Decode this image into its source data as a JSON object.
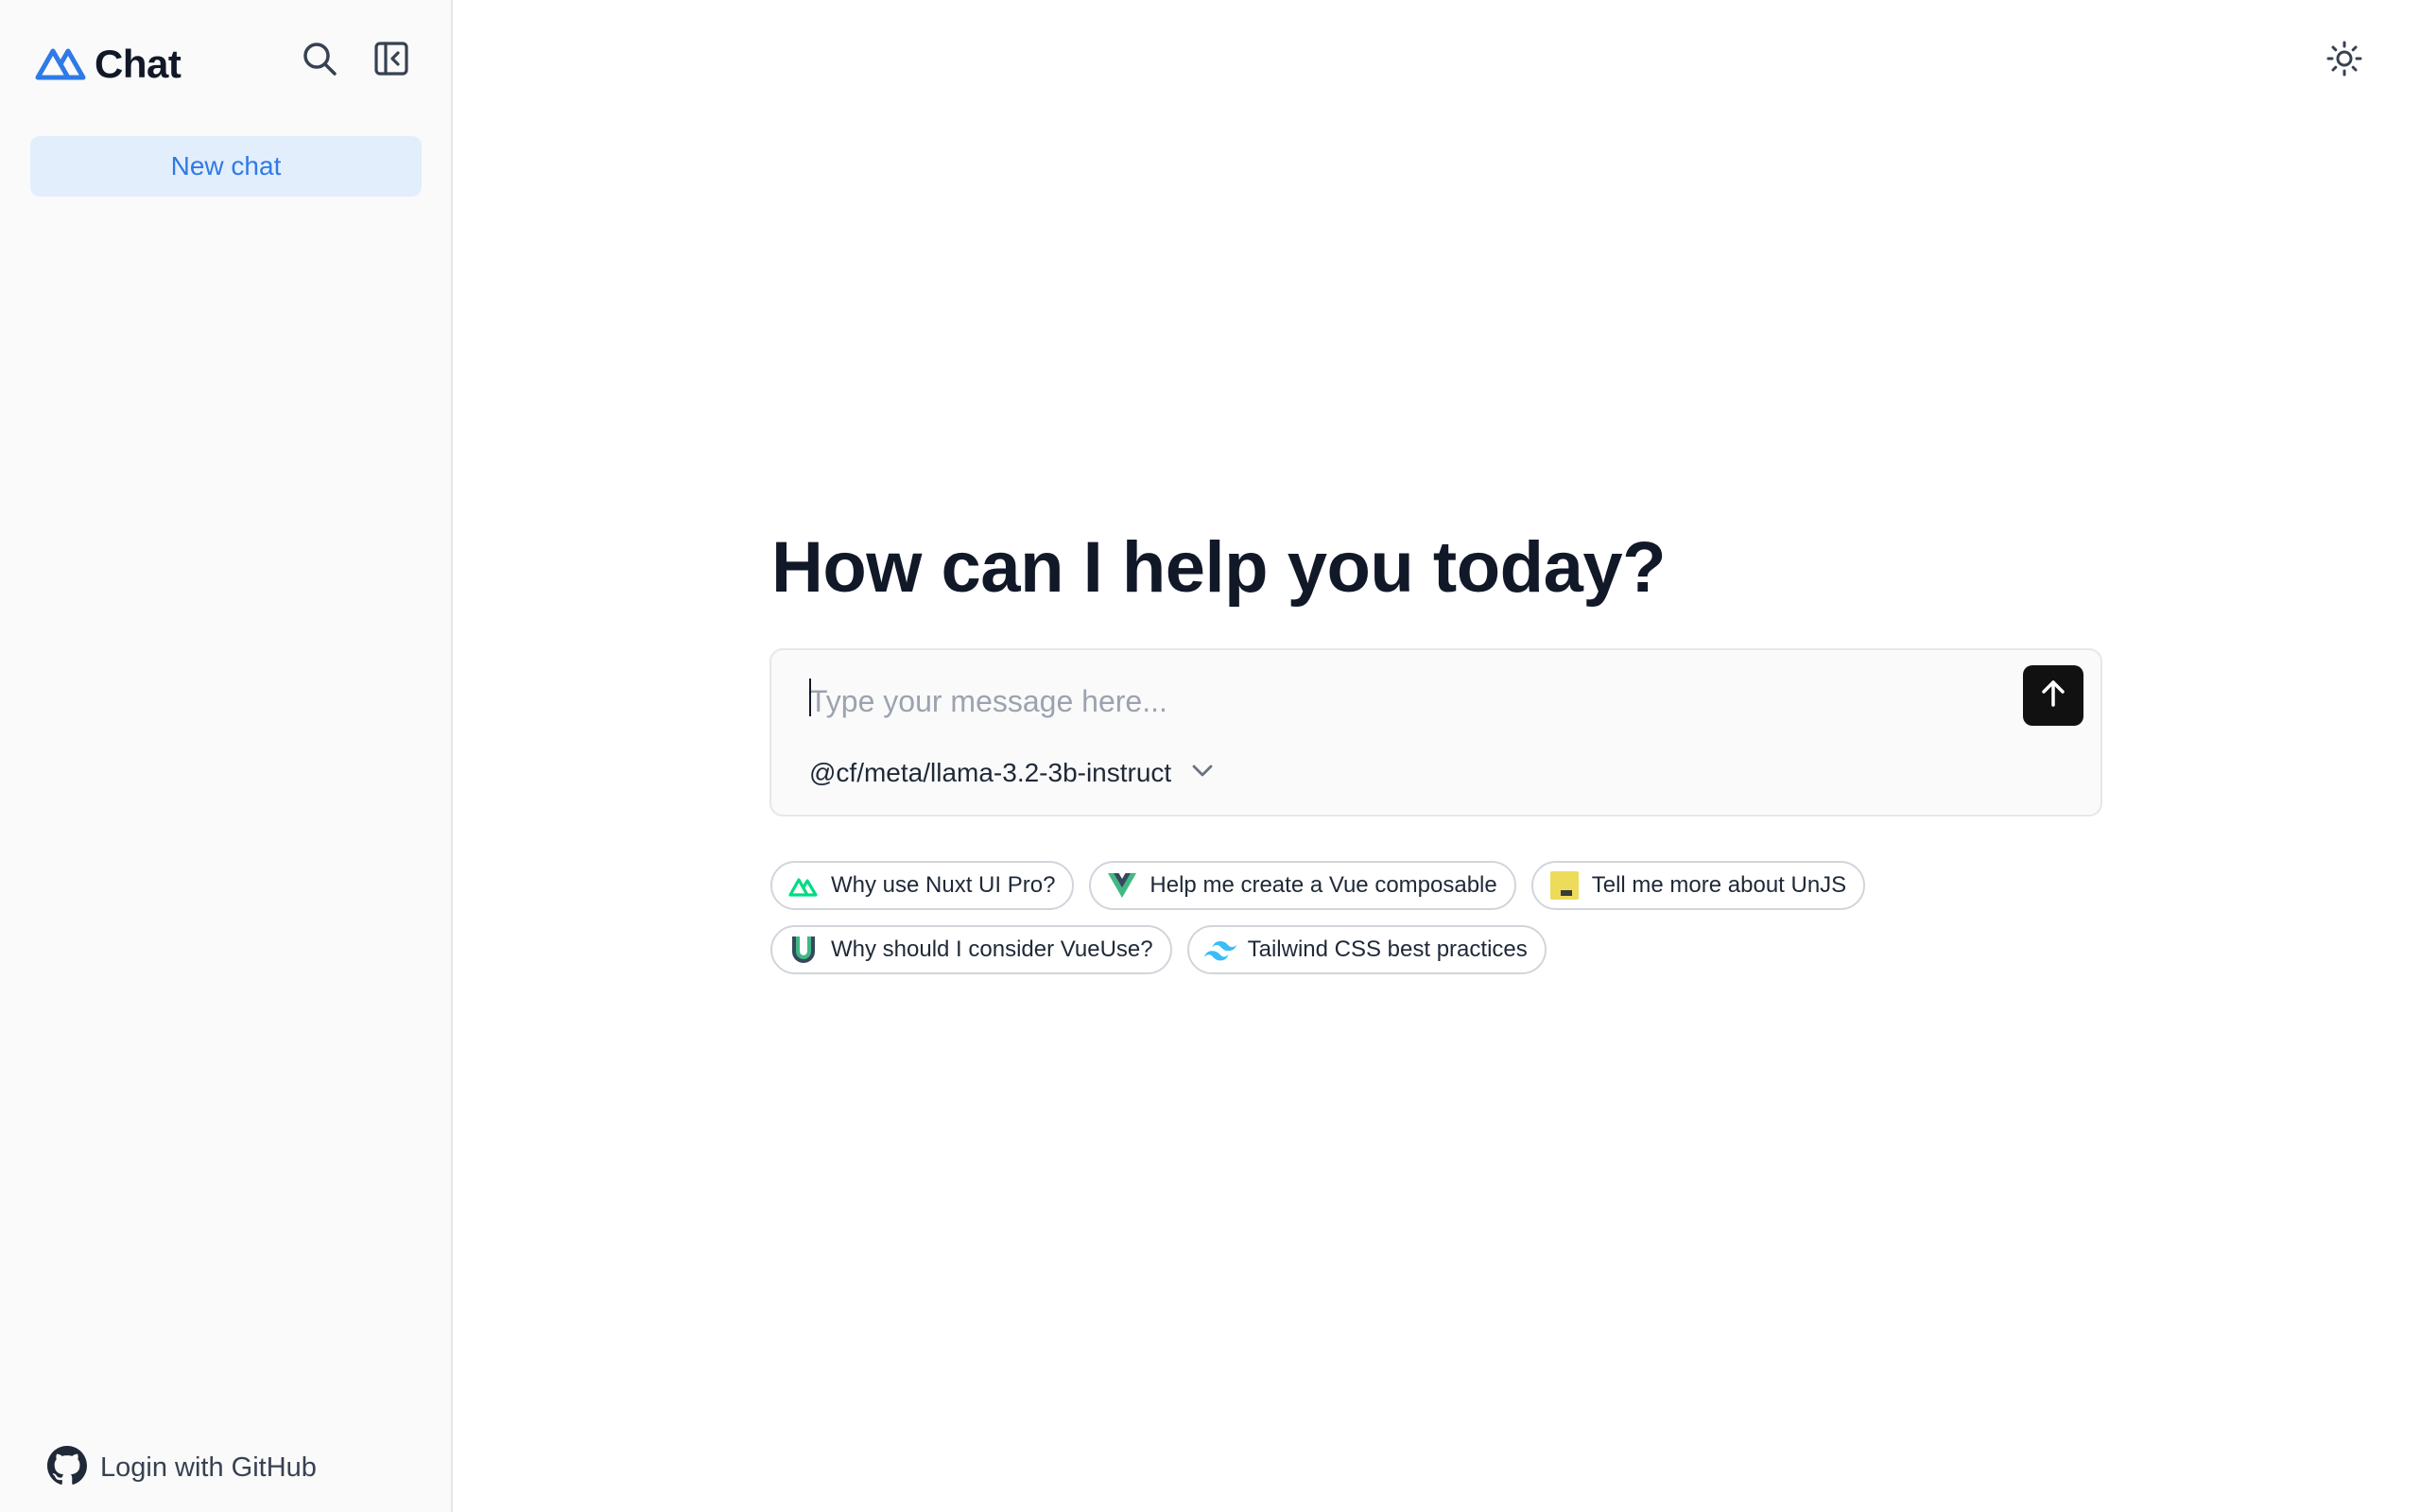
{
  "sidebar": {
    "brand_title": "Chat",
    "new_chat_label": "New chat",
    "login_label": "Login with GitHub"
  },
  "main": {
    "heading": "How can I help you today?",
    "composer": {
      "placeholder": "Type your message here...",
      "value": "",
      "model": "@cf/meta/llama-3.2-3b-instruct"
    },
    "suggestions": [
      {
        "label": "Why use Nuxt UI Pro?",
        "icon": "nuxt-icon"
      },
      {
        "label": "Help me create a Vue composable",
        "icon": "vue-icon"
      },
      {
        "label": "Tell me more about UnJS",
        "icon": "unjs-icon"
      },
      {
        "label": "Why should I consider VueUse?",
        "icon": "vueuse-icon"
      },
      {
        "label": "Tailwind CSS best practices",
        "icon": "tailwind-icon"
      }
    ]
  },
  "icons": {
    "brand": "nuxt-chat-logo-icon",
    "search": "search-icon",
    "sidebar_toggle": "sidebar-collapse-icon",
    "theme": "sun-icon",
    "send": "arrow-up-icon",
    "model_dropdown": "chevron-down-icon",
    "login": "github-icon"
  },
  "colors": {
    "accent": "#2f7ae5",
    "new_chat_bg": "#e3eefc",
    "send_bg": "#111111",
    "nuxt_green": "#00dc82",
    "vue_green": "#42b883",
    "unjs_yellow": "#ecdc5a",
    "tailwind_cyan": "#38bdf8"
  }
}
